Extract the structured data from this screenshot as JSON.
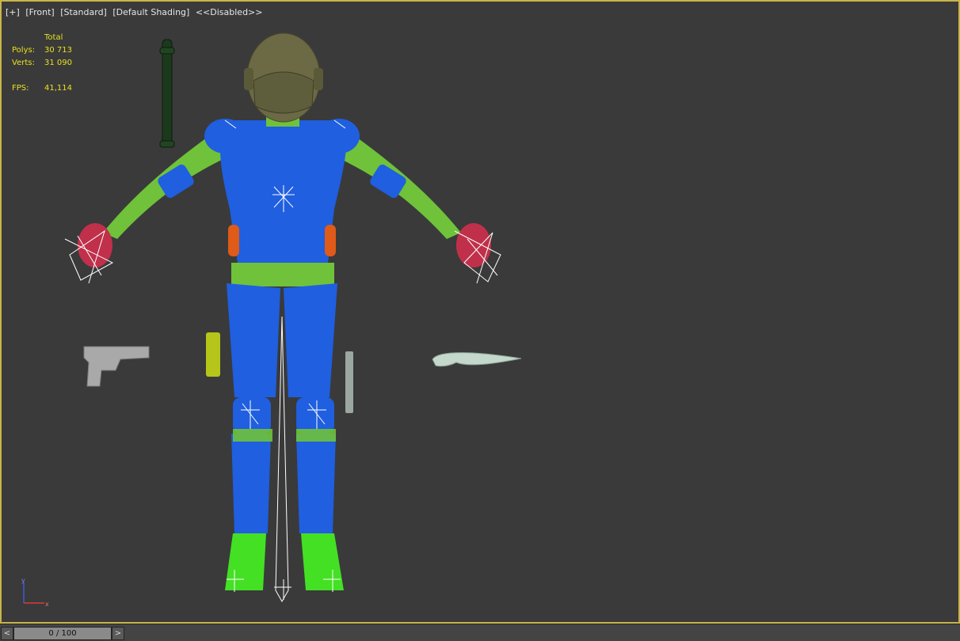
{
  "viewport": {
    "labels": [
      "[+]",
      "[Front]",
      "[Standard]",
      "[Default Shading]",
      "<<Disabled>>"
    ]
  },
  "stats": {
    "header": "Total",
    "polys_label": "Polys:",
    "polys_value": "30 713",
    "verts_label": "Verts:",
    "verts_value": "31 090",
    "fps_label": "FPS:",
    "fps_value": "41,114"
  },
  "axis": {
    "y": "y",
    "x": "x"
  },
  "timeline": {
    "prev": "<",
    "frame": "0 / 100",
    "next": ">"
  },
  "colors": {
    "suit_blue": "#1f5fe0",
    "suit_green": "#6fc23a",
    "helmet": "#6b6a44",
    "viewport_border": "#c8b44a",
    "stats_text": "#e8e020"
  }
}
